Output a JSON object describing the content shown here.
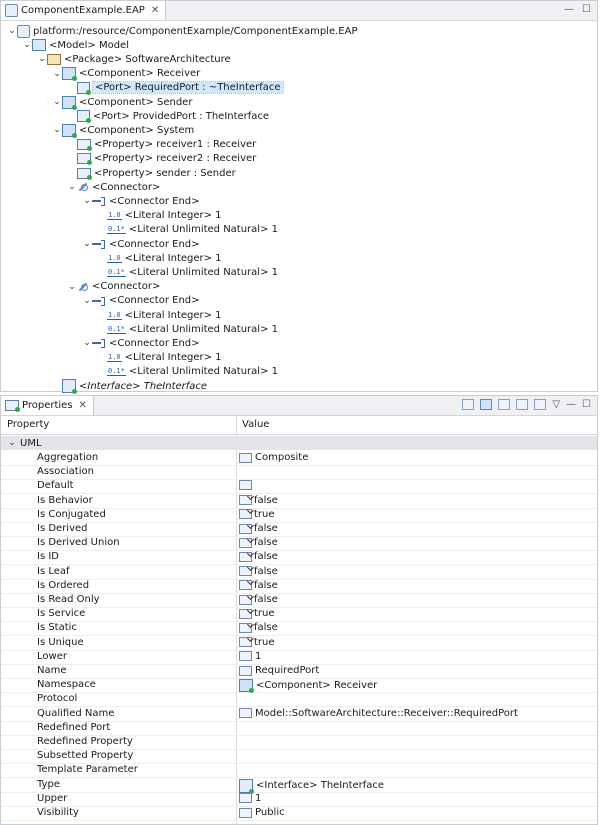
{
  "editor": {
    "tab_title": "ComponentExample.EAP",
    "tree": [
      {
        "label": "platform:/resource/ComponentExample/ComponentExample.EAP",
        "icon": "resource-icon",
        "level": 0,
        "chev": "down"
      },
      {
        "label": "<Model> Model",
        "icon": "model-icon",
        "level": 1,
        "chev": "down"
      },
      {
        "label": "<Package> SoftwareArchitecture",
        "icon": "package-icon",
        "level": 2,
        "chev": "down"
      },
      {
        "label": "<Component> Receiver",
        "icon": "component-icon",
        "level": 3,
        "chev": "down"
      },
      {
        "label": "<Port> RequiredPort : ~TheInterface",
        "icon": "port-icon",
        "level": 4,
        "chev": "none",
        "selected": true
      },
      {
        "label": "<Component> Sender",
        "icon": "component-icon",
        "level": 3,
        "chev": "down"
      },
      {
        "label": "<Port> ProvidedPort : TheInterface",
        "icon": "port-icon",
        "level": 4,
        "chev": "none"
      },
      {
        "label": "<Component> System",
        "icon": "component-icon",
        "level": 3,
        "chev": "down"
      },
      {
        "label": "<Property> receiver1 : Receiver",
        "icon": "property-icon",
        "level": 4,
        "chev": "none"
      },
      {
        "label": "<Property> receiver2 : Receiver",
        "icon": "property-icon",
        "level": 4,
        "chev": "none"
      },
      {
        "label": "<Property> sender : Sender",
        "icon": "property-icon",
        "level": 4,
        "chev": "none"
      },
      {
        "label": "<Connector>",
        "icon": "connector-icon",
        "level": 4,
        "chev": "down"
      },
      {
        "label": "<Connector End>",
        "icon": "connector-end-icon",
        "level": 5,
        "chev": "down"
      },
      {
        "label": "<Literal Integer> 1",
        "icon": "literal-integer-icon",
        "level": 6,
        "chev": "none"
      },
      {
        "label": "<Literal Unlimited Natural> 1",
        "icon": "literal-unlimited-icon",
        "level": 6,
        "chev": "none"
      },
      {
        "label": "<Connector End>",
        "icon": "connector-end-icon",
        "level": 5,
        "chev": "down"
      },
      {
        "label": "<Literal Integer> 1",
        "icon": "literal-integer-icon",
        "level": 6,
        "chev": "none"
      },
      {
        "label": "<Literal Unlimited Natural> 1",
        "icon": "literal-unlimited-icon",
        "level": 6,
        "chev": "none"
      },
      {
        "label": "<Connector>",
        "icon": "connector-icon",
        "level": 4,
        "chev": "down"
      },
      {
        "label": "<Connector End>",
        "icon": "connector-end-icon",
        "level": 5,
        "chev": "down"
      },
      {
        "label": "<Literal Integer> 1",
        "icon": "literal-integer-icon",
        "level": 6,
        "chev": "none"
      },
      {
        "label": "<Literal Unlimited Natural> 1",
        "icon": "literal-unlimited-icon",
        "level": 6,
        "chev": "none"
      },
      {
        "label": "<Connector End>",
        "icon": "connector-end-icon",
        "level": 5,
        "chev": "down"
      },
      {
        "label": "<Literal Integer> 1",
        "icon": "literal-integer-icon",
        "level": 6,
        "chev": "none"
      },
      {
        "label": "<Literal Unlimited Natural> 1",
        "icon": "literal-unlimited-icon",
        "level": 6,
        "chev": "none"
      },
      {
        "label": "<Interface> TheInterface",
        "icon": "interface-icon",
        "level": 3,
        "chev": "none",
        "italic": true
      }
    ]
  },
  "properties": {
    "tab_title": "Properties",
    "col_property": "Property",
    "col_value": "Value",
    "category": "UML",
    "rows": [
      {
        "name": "Aggregation",
        "value": "Composite",
        "icon": "value-icon"
      },
      {
        "name": "Association",
        "value": "",
        "icon": ""
      },
      {
        "name": "Default",
        "value": "",
        "icon": "value-icon"
      },
      {
        "name": "Is Behavior",
        "value": "false",
        "icon": "boolean-icon"
      },
      {
        "name": "Is Conjugated",
        "value": "true",
        "icon": "boolean-icon"
      },
      {
        "name": "Is Derived",
        "value": "false",
        "icon": "boolean-icon"
      },
      {
        "name": "Is Derived Union",
        "value": "false",
        "icon": "boolean-icon"
      },
      {
        "name": "Is ID",
        "value": "false",
        "icon": "boolean-icon"
      },
      {
        "name": "Is Leaf",
        "value": "false",
        "icon": "boolean-icon"
      },
      {
        "name": "Is Ordered",
        "value": "false",
        "icon": "boolean-icon"
      },
      {
        "name": "Is Read Only",
        "value": "false",
        "icon": "boolean-icon"
      },
      {
        "name": "Is Service",
        "value": "true",
        "icon": "boolean-icon"
      },
      {
        "name": "Is Static",
        "value": "false",
        "icon": "boolean-icon"
      },
      {
        "name": "Is Unique",
        "value": "true",
        "icon": "boolean-icon"
      },
      {
        "name": "Lower",
        "value": "1",
        "icon": "number-icon"
      },
      {
        "name": "Name",
        "value": "RequiredPort",
        "icon": "value-icon"
      },
      {
        "name": "Namespace",
        "value": "<Component> Receiver",
        "icon": "component-icon"
      },
      {
        "name": "Protocol",
        "value": "",
        "icon": ""
      },
      {
        "name": "Qualified Name",
        "value": "Model::SoftwareArchitecture::Receiver::RequiredPort",
        "icon": "value-icon"
      },
      {
        "name": "Redefined Port",
        "value": "",
        "icon": ""
      },
      {
        "name": "Redefined Property",
        "value": "",
        "icon": ""
      },
      {
        "name": "Subsetted Property",
        "value": "",
        "icon": ""
      },
      {
        "name": "Template Parameter",
        "value": "",
        "icon": ""
      },
      {
        "name": "Type",
        "value": "<Interface> TheInterface",
        "icon": "interface-icon"
      },
      {
        "name": "Upper",
        "value": "1",
        "icon": "number-icon"
      },
      {
        "name": "Visibility",
        "value": "Public",
        "icon": "value-icon"
      }
    ]
  }
}
